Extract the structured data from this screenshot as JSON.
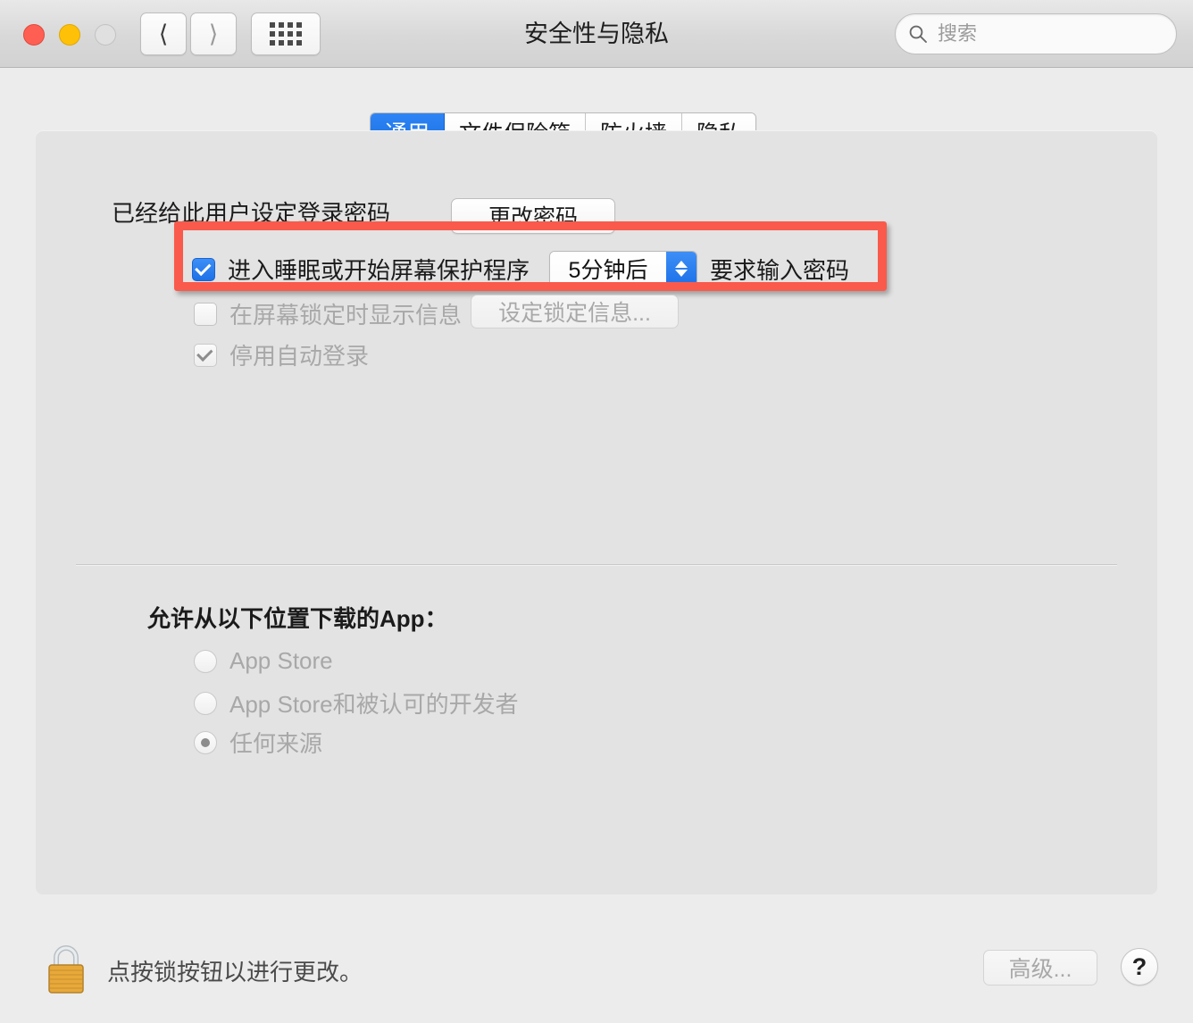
{
  "window": {
    "title": "安全性与隐私",
    "traffic_lights": [
      "close",
      "minimize",
      "zoom"
    ],
    "nav": {
      "back_icon": "chevron-left-icon",
      "forward_icon": "chevron-right-icon",
      "grid_icon": "grid-dots-icon"
    },
    "search": {
      "placeholder": "搜索",
      "value": "",
      "icon": "search-icon"
    }
  },
  "tabs": [
    {
      "label": "通用",
      "selected": true
    },
    {
      "label": "文件保险箱",
      "selected": false
    },
    {
      "label": "防火墙",
      "selected": false
    },
    {
      "label": "隐私",
      "selected": false
    }
  ],
  "general": {
    "login_password_text": "已经给此用户设定登录密码",
    "change_password_button": "更改密码",
    "require_password": {
      "checked": true,
      "label": "进入睡眠或开始屏幕保护程序",
      "delay_value": "5分钟后",
      "suffix": "要求输入密码",
      "stepper_icon": "stepper-up-down-icon"
    },
    "show_lock_message": {
      "checked": false,
      "label": "在屏幕锁定时显示信息",
      "button": "设定锁定信息..."
    },
    "disable_auto_login": {
      "checked": true,
      "label": "停用自动登录"
    }
  },
  "downloads": {
    "heading": "允许从以下位置下载的App：",
    "options": [
      {
        "label": "App Store",
        "selected": false
      },
      {
        "label": "App Store和被认可的开发者",
        "selected": false
      },
      {
        "label": "任何来源",
        "selected": true
      }
    ]
  },
  "footer": {
    "lock_icon": "lock-closed-icon",
    "lock_status_text": "点按锁按钮以进行更改。",
    "advanced_button": "高级...",
    "help_button": "?"
  },
  "highlight": {
    "color": "#fa5a4b",
    "target": "require-password-row"
  }
}
